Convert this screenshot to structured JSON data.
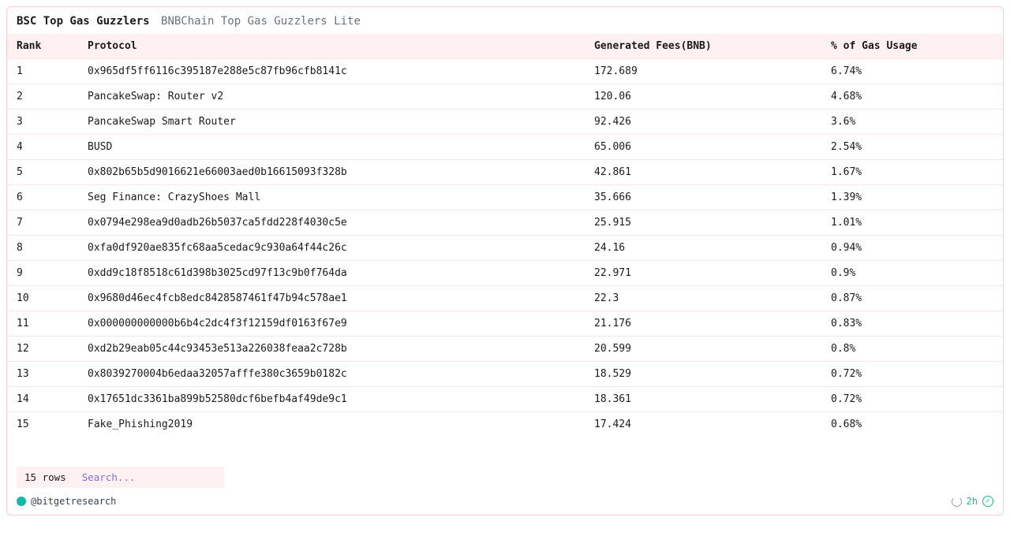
{
  "header": {
    "title_main": "BSC Top Gas Guzzlers",
    "title_sub": "BNBChain Top Gas Guzzlers Lite"
  },
  "columns": {
    "rank": "Rank",
    "protocol": "Protocol",
    "fees": "Generated Fees(BNB)",
    "pct": "% of Gas Usage"
  },
  "rows": [
    {
      "rank": "1",
      "protocol": "0x965df5ff6116c395187e288e5c87fb96cfb8141c",
      "fees": "172.689",
      "pct": "6.74%"
    },
    {
      "rank": "2",
      "protocol": "PancakeSwap: Router v2",
      "fees": "120.06",
      "pct": "4.68%"
    },
    {
      "rank": "3",
      "protocol": "PancakeSwap Smart Router",
      "fees": "92.426",
      "pct": "3.6%"
    },
    {
      "rank": "4",
      "protocol": "BUSD",
      "fees": "65.006",
      "pct": "2.54%"
    },
    {
      "rank": "5",
      "protocol": "0x802b65b5d9016621e66003aed0b16615093f328b",
      "fees": "42.861",
      "pct": "1.67%"
    },
    {
      "rank": "6",
      "protocol": "Seg Finance: CrazyShoes Mall",
      "fees": "35.666",
      "pct": "1.39%"
    },
    {
      "rank": "7",
      "protocol": "0x0794e298ea9d0adb26b5037ca5fdd228f4030c5e",
      "fees": "25.915",
      "pct": "1.01%"
    },
    {
      "rank": "8",
      "protocol": "0xfa0df920ae835fc68aa5cedac9c930a64f44c26c",
      "fees": "24.16",
      "pct": "0.94%"
    },
    {
      "rank": "9",
      "protocol": "0xdd9c18f8518c61d398b3025cd97f13c9b0f764da",
      "fees": "22.971",
      "pct": "0.9%"
    },
    {
      "rank": "10",
      "protocol": "0x9680d46ec4fcb8edc8428587461f47b94c578ae1",
      "fees": "22.3",
      "pct": "0.87%"
    },
    {
      "rank": "11",
      "protocol": "0x000000000000b6b4c2dc4f3f12159df0163f67e9",
      "fees": "21.176",
      "pct": "0.83%"
    },
    {
      "rank": "12",
      "protocol": "0xd2b29eab05c44c93453e513a226038feaa2c728b",
      "fees": "20.599",
      "pct": "0.8%"
    },
    {
      "rank": "13",
      "protocol": "0x8039270004b6edaa32057afffe380c3659b0182c",
      "fees": "18.529",
      "pct": "0.72%"
    },
    {
      "rank": "14",
      "protocol": "0x17651dc3361ba899b52580dcf6befb4af49de9c1",
      "fees": "18.361",
      "pct": "0.72%"
    },
    {
      "rank": "15",
      "protocol": "Fake_Phishing2019",
      "fees": "17.424",
      "pct": "0.68%"
    }
  ],
  "footer": {
    "rowcount": "15 rows",
    "search_placeholder": "Search..."
  },
  "attrib": {
    "handle": "@bitgetresearch",
    "age": "2h"
  }
}
